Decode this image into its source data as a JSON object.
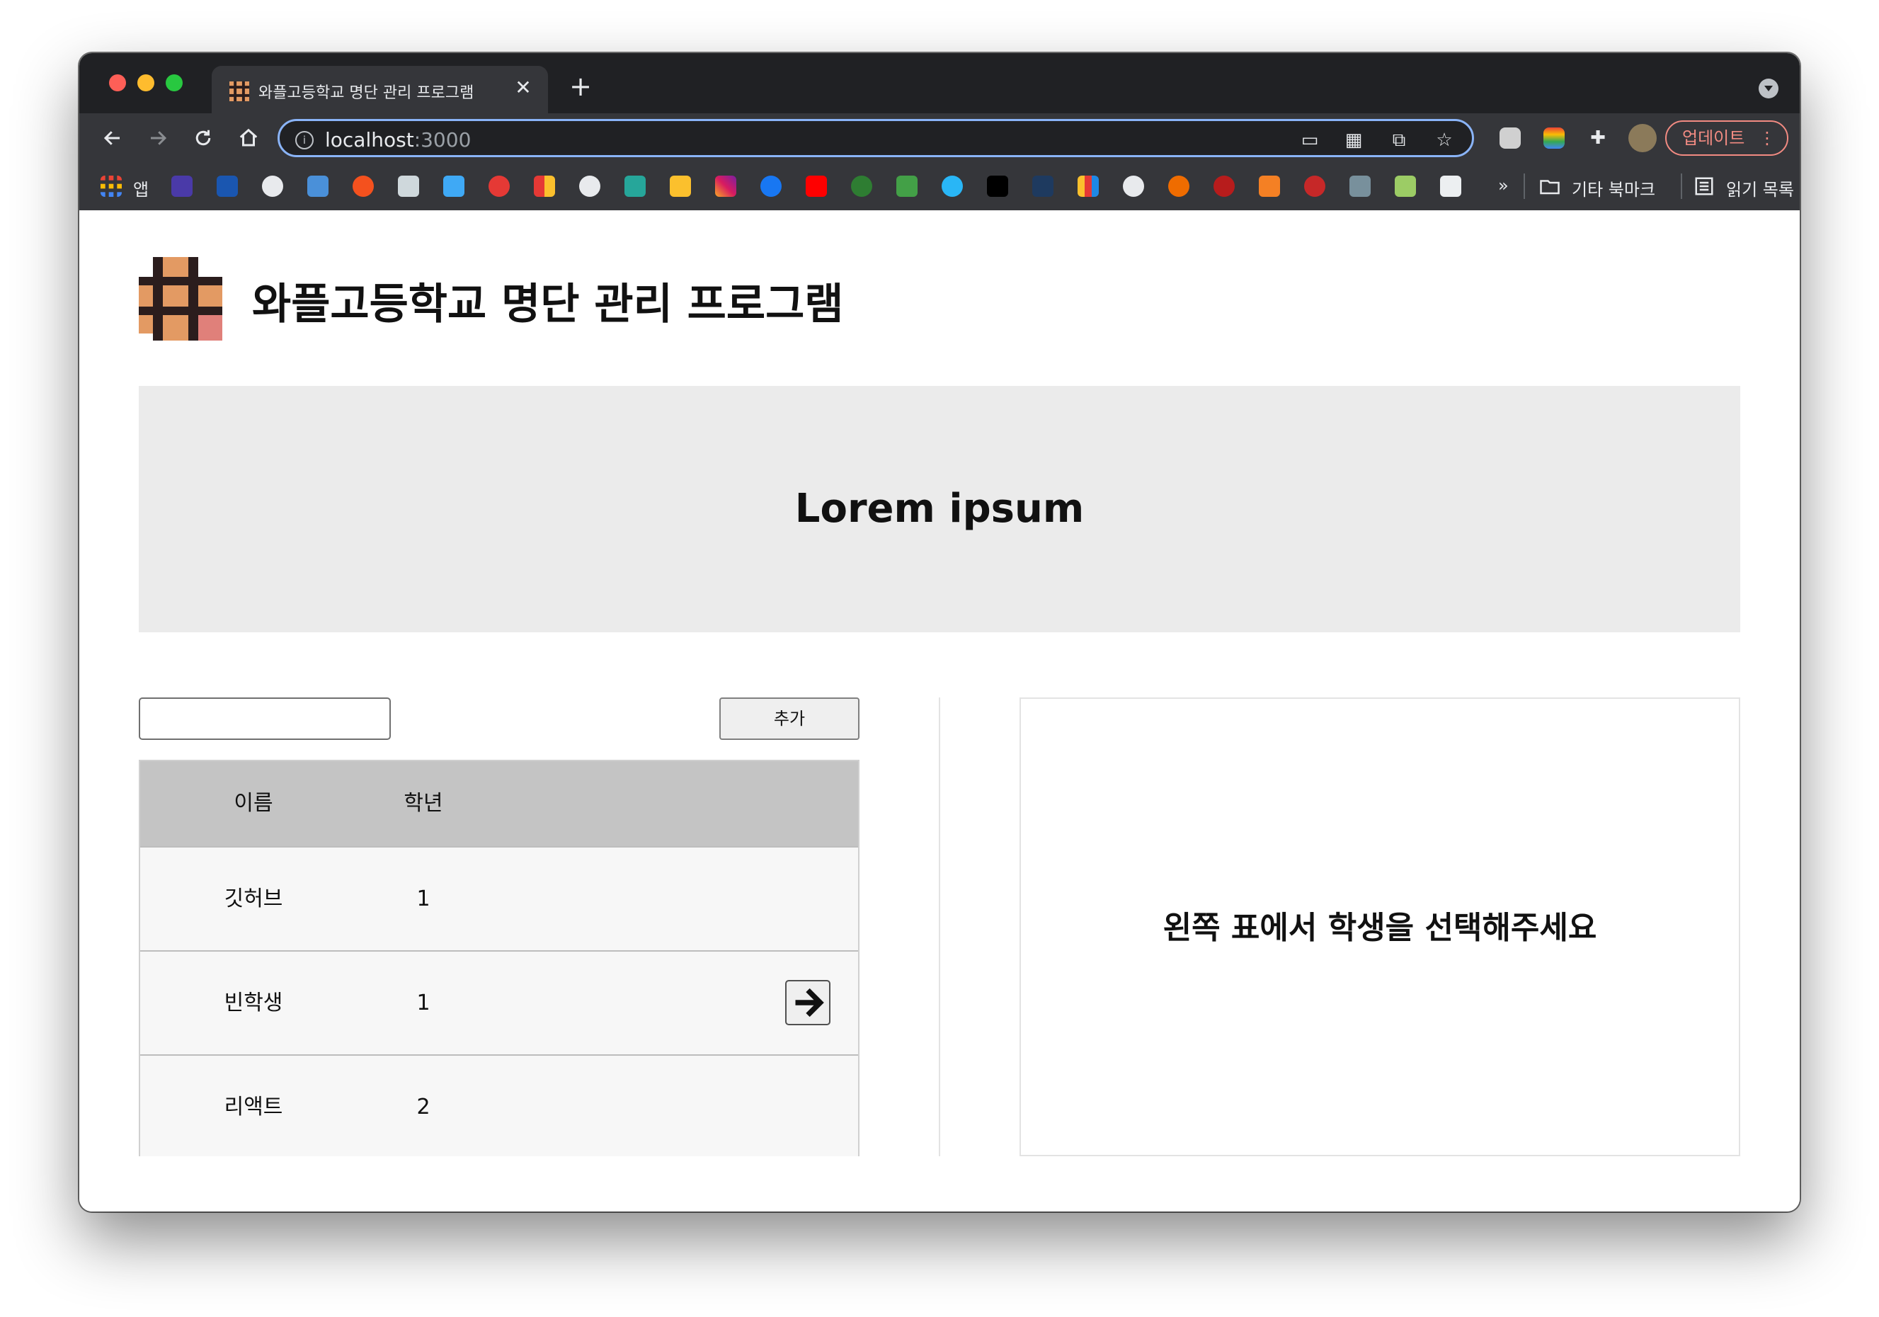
{
  "browser": {
    "tab_title": "와플고등학교 명단 관리 프로그램",
    "tab_close": "✕",
    "new_tab": "+",
    "url_host": "localhost",
    "url_port": ":3000",
    "update_label": "업데이트",
    "update_menu": "⋮",
    "bookmarks": {
      "apps_label": "앱",
      "more": "»",
      "other_label": "기타 북마크",
      "reading_label": "읽기 목록"
    }
  },
  "page": {
    "title": "와플고등학교 명단 관리 프로그램",
    "hero_text": "Lorem ipsum",
    "add_button": "추가",
    "input_value": "",
    "table": {
      "headers": [
        "이름",
        "학년"
      ],
      "rows": [
        {
          "name": "깃허브",
          "grade": "1"
        },
        {
          "name": "빈학생",
          "grade": "1"
        },
        {
          "name": "리액트",
          "grade": "2"
        }
      ]
    },
    "detail_placeholder": "왼쪽 표에서 학생을 선택해주세요"
  },
  "colors": {
    "logo_dark": "#2b1d1d",
    "logo_orange": "#e39a63",
    "logo_pink": "#e0807a",
    "hero_bg": "#ebebeb",
    "table_header_bg": "#c4c4c4",
    "update_accent": "#f28b82"
  },
  "icons": {
    "back": "arrow-left-icon",
    "forward": "arrow-right-icon",
    "reload": "reload-icon",
    "home": "home-icon",
    "row_action": "arrow-right-icon"
  }
}
